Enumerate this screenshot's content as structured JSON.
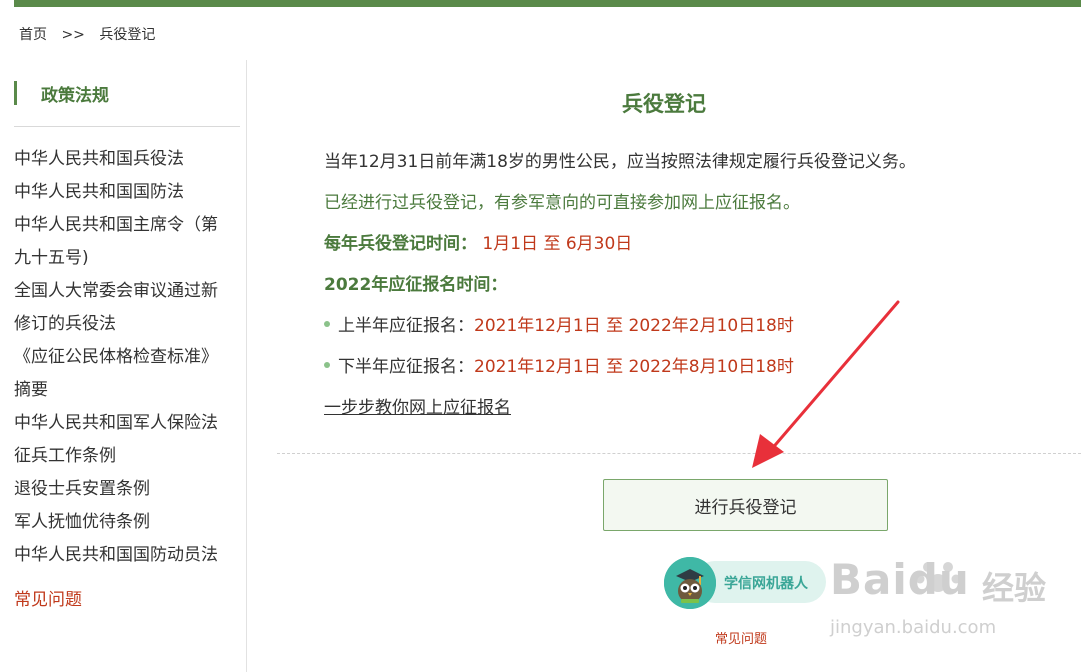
{
  "breadcrumb": {
    "home": "首页",
    "separator": ">>",
    "current": "兵役登记"
  },
  "sidebar": {
    "title": "政策法规",
    "items": [
      "中华人民共和国兵役法",
      "中华人民共和国国防法",
      "中华人民共和国主席令（第",
      "九十五号)",
      "全国人大常委会审议通过新",
      "修订的兵役法",
      "《应征公民体格检查标准》",
      "摘要",
      "中华人民共和国军人保险法",
      "征兵工作条例",
      "退役士兵安置条例",
      "军人抚恤优待条例",
      "中华人民共和国国防动员法"
    ],
    "faq": "常见问题"
  },
  "main": {
    "title": "兵役登记",
    "para1": "当年12月31日前年满18岁的男性公民，应当按照法律规定履行兵役登记义务。",
    "para2": "已经进行过兵役登记，有参军意向的可直接参加网上应征报名。",
    "reg_time_label": "每年兵役登记时间：",
    "reg_time_value": "1月1日 至 6月30日",
    "apply_time_label": "2022年应征报名时间：",
    "first_half_label": "上半年应征报名：",
    "first_half_value": "2021年12月1日 至 2022年2月10日18时",
    "second_half_label": "下半年应征报名：",
    "second_half_value": "2021年12月1日 至 2022年8月10日18时",
    "guide_link": "一步步教你网上应征报名",
    "register_button": "进行兵役登记",
    "robot_label": "学信网机器人",
    "faq": "常见问题"
  },
  "watermark": {
    "brand": "Baidu",
    "cn": "经验",
    "url": "jingyan.baidu.com"
  },
  "colors": {
    "accent_green": "#5a8a4a",
    "title_green": "#4b7a3d",
    "red": "#c0391b",
    "arrow": "#e8303a"
  }
}
